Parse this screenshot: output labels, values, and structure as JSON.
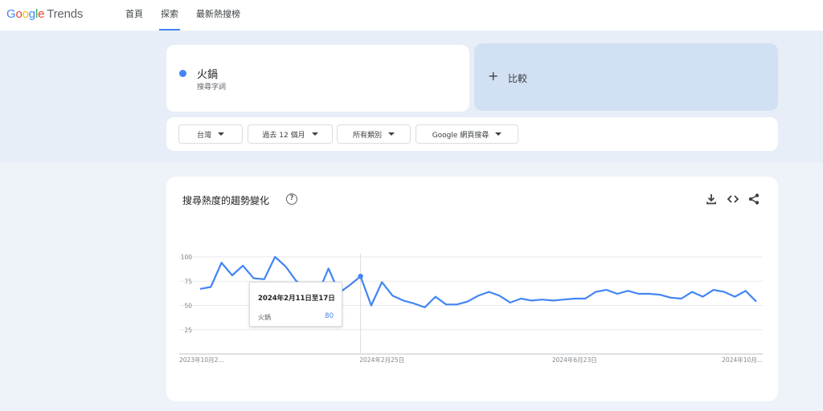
{
  "header": {
    "logo_google": "Google",
    "logo_trends": "Trends",
    "nav": [
      "首頁",
      "探索",
      "最新熱搜榜"
    ],
    "active_nav": 1
  },
  "search_term": {
    "name": "火鍋",
    "subtitle": "搜尋字詞",
    "color": "#4285f4"
  },
  "compare": {
    "plus": "+",
    "label": "比較"
  },
  "filters": [
    "台灣",
    "過去 12 個月",
    "所有類別",
    "Google 網頁搜尋"
  ],
  "chart_card": {
    "title": "搜尋熱度的趨勢變化",
    "help_icon": "?",
    "actions": [
      "download-icon",
      "embed-icon",
      "share-icon"
    ]
  },
  "chart_data": {
    "type": "line",
    "series": [
      {
        "name": "火鍋",
        "color": "#4285f4",
        "values": [
          67,
          69,
          94,
          81,
          91,
          78,
          77,
          100,
          90,
          75,
          68,
          62,
          88,
          63,
          71,
          80,
          50,
          74,
          60,
          55,
          52,
          48,
          59,
          51,
          51,
          54,
          60,
          64,
          60,
          53,
          57,
          55,
          56,
          55,
          56,
          57,
          57,
          64,
          66,
          62,
          65,
          62,
          62,
          61,
          58,
          57,
          64,
          59,
          66,
          64,
          59,
          65,
          54
        ]
      }
    ],
    "x_tick_labels": [
      "2023年10月2...",
      "2024年2月25日",
      "2024年6月23日",
      "2024年10月..."
    ],
    "x_tick_index": [
      0,
      17,
      35,
      53
    ],
    "y_ticks": [
      100,
      75,
      50,
      25
    ],
    "ylim": [
      0,
      100
    ],
    "grid": true,
    "hover_index": 15
  },
  "tooltip": {
    "date": "2024年2月11日至17日",
    "term": "火鍋",
    "value": "80"
  }
}
